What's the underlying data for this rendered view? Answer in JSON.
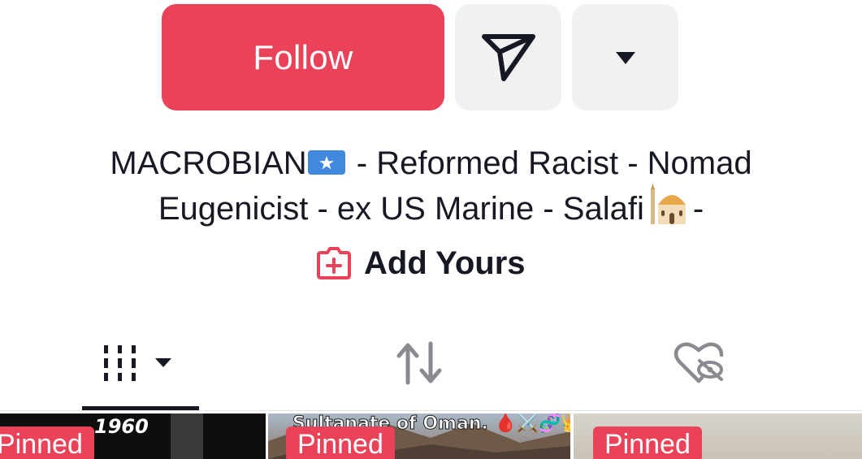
{
  "actions": {
    "follow_label": "Follow",
    "share_icon": "send-icon",
    "more_icon": "caret-down-icon"
  },
  "bio": {
    "line1": "MACROBIAN",
    "line1_rest": " - Reformed Racist - Nomad",
    "line2": "Eugenicist - ex US Marine - Salafi",
    "line2_end": "-",
    "flag_icon": "somalia-flag-icon",
    "mosque_icon": "mosque-icon"
  },
  "add_yours": {
    "label": "Add Yours",
    "icon": "add-yours-icon"
  },
  "tabs": [
    {
      "name": "videos",
      "icon": "grid-icon",
      "active": true
    },
    {
      "name": "reposts",
      "icon": "repost-icon",
      "active": false
    },
    {
      "name": "liked",
      "icon": "liked-hidden-icon",
      "active": false
    }
  ],
  "videos": [
    {
      "pinned_label": "Pinned",
      "overlay_text": "1960"
    },
    {
      "pinned_label": "Pinned",
      "overlay_text": "Sultanate of Oman. 🩸⚔️🧬👑"
    },
    {
      "pinned_label": "Pinned",
      "overlay_text": ""
    }
  ],
  "colors": {
    "accent": "#ea4359",
    "button_bg": "#f1f1f2",
    "text": "#161823"
  }
}
